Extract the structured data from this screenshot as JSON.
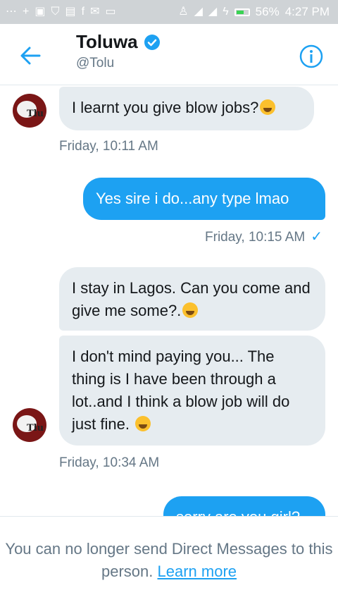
{
  "status_bar": {
    "battery": "56%",
    "time": "4:27 PM",
    "icons": [
      "dots-icon",
      "plus-icon",
      "gallery-icon",
      "shield-icon",
      "news-icon",
      "facebook-icon",
      "mail-icon",
      "chat-icon",
      "android-icon",
      "signal-icon",
      "signal-icon",
      "charging-icon",
      "battery-icon"
    ]
  },
  "header": {
    "name": "Toluwa",
    "handle": "@Tolu",
    "verified": true
  },
  "avatar": {
    "label": "Tlu"
  },
  "conversation": {
    "messages": [
      {
        "direction": "in",
        "text": "I learnt you give blow jobs?",
        "emoji": "grinning-face"
      },
      {
        "direction": "out",
        "text": "Yes sire i do...any type lmao"
      },
      {
        "direction": "in",
        "text": "I stay in Lagos. Can you come and give me some?.",
        "emoji": "squinting-face"
      },
      {
        "direction": "in",
        "text": "I don't mind paying you... The thing is I have been through a lot..and I think a blow job will do just fine.",
        "emoji": "tired-face"
      },
      {
        "direction": "out",
        "text": "sorry are you girl?"
      }
    ],
    "timestamps": {
      "t1": "Friday, 10:11 AM",
      "t2": "Friday, 10:15 AM",
      "t3": "Friday, 10:34 AM"
    }
  },
  "footer": {
    "text": "You can no longer send Direct Messages to this person.",
    "link": "Learn more"
  },
  "colors": {
    "accent": "#1da1f2",
    "incoming_bubble": "#e6ecf0",
    "muted_text": "#657786",
    "avatar_bg": "#7a1616"
  }
}
